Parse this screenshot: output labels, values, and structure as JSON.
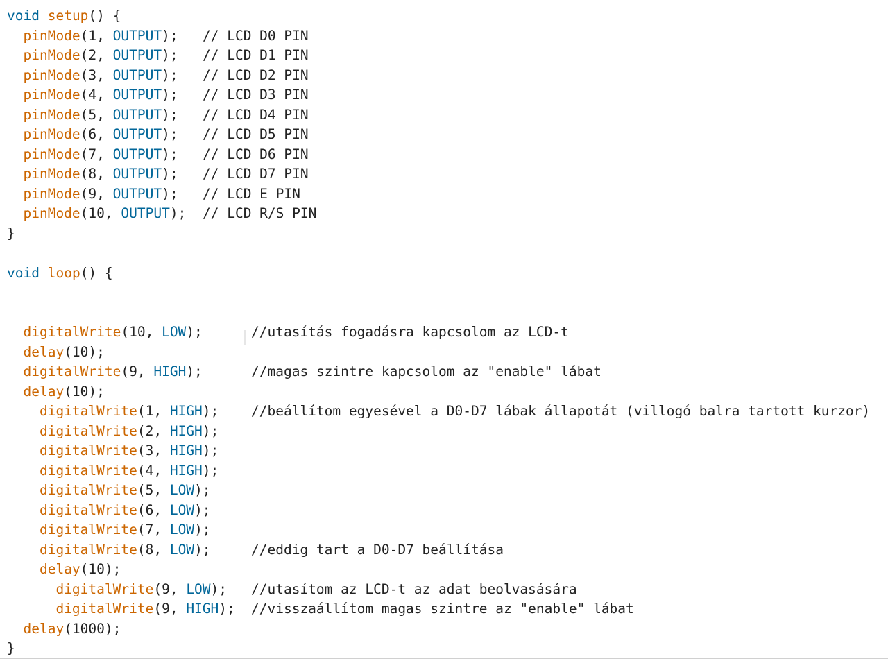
{
  "colors": {
    "keyword": "#cc6600",
    "constant": "#006699",
    "text": "#222222",
    "background": "#ffffff"
  },
  "code": {
    "lines": [
      {
        "tokens": [
          {
            "text": "void",
            "cls": "cst"
          },
          {
            "text": " "
          },
          {
            "text": "setup",
            "cls": "kw"
          },
          {
            "text": "() {"
          }
        ]
      },
      {
        "tokens": [
          {
            "text": "  "
          },
          {
            "text": "pinMode",
            "cls": "kw"
          },
          {
            "text": "(1, "
          },
          {
            "text": "OUTPUT",
            "cls": "cst"
          },
          {
            "text": ");"
          }
        ],
        "comment": "// LCD D0 PIN"
      },
      {
        "tokens": [
          {
            "text": "  "
          },
          {
            "text": "pinMode",
            "cls": "kw"
          },
          {
            "text": "(2, "
          },
          {
            "text": "OUTPUT",
            "cls": "cst"
          },
          {
            "text": ");"
          }
        ],
        "comment": "// LCD D1 PIN"
      },
      {
        "tokens": [
          {
            "text": "  "
          },
          {
            "text": "pinMode",
            "cls": "kw"
          },
          {
            "text": "(3, "
          },
          {
            "text": "OUTPUT",
            "cls": "cst"
          },
          {
            "text": ");"
          }
        ],
        "comment": "// LCD D2 PIN"
      },
      {
        "tokens": [
          {
            "text": "  "
          },
          {
            "text": "pinMode",
            "cls": "kw"
          },
          {
            "text": "(4, "
          },
          {
            "text": "OUTPUT",
            "cls": "cst"
          },
          {
            "text": ");"
          }
        ],
        "comment": "// LCD D3 PIN"
      },
      {
        "tokens": [
          {
            "text": "  "
          },
          {
            "text": "pinMode",
            "cls": "kw"
          },
          {
            "text": "(5, "
          },
          {
            "text": "OUTPUT",
            "cls": "cst"
          },
          {
            "text": ");"
          }
        ],
        "comment": "// LCD D4 PIN"
      },
      {
        "tokens": [
          {
            "text": "  "
          },
          {
            "text": "pinMode",
            "cls": "kw"
          },
          {
            "text": "(6, "
          },
          {
            "text": "OUTPUT",
            "cls": "cst"
          },
          {
            "text": ");"
          }
        ],
        "comment": "// LCD D5 PIN"
      },
      {
        "tokens": [
          {
            "text": "  "
          },
          {
            "text": "pinMode",
            "cls": "kw"
          },
          {
            "text": "(7, "
          },
          {
            "text": "OUTPUT",
            "cls": "cst"
          },
          {
            "text": ");"
          }
        ],
        "comment": "// LCD D6 PIN"
      },
      {
        "tokens": [
          {
            "text": "  "
          },
          {
            "text": "pinMode",
            "cls": "kw"
          },
          {
            "text": "(8, "
          },
          {
            "text": "OUTPUT",
            "cls": "cst"
          },
          {
            "text": ");"
          }
        ],
        "comment": "// LCD D7 PIN"
      },
      {
        "tokens": [
          {
            "text": "  "
          },
          {
            "text": "pinMode",
            "cls": "kw"
          },
          {
            "text": "(9, "
          },
          {
            "text": "OUTPUT",
            "cls": "cst"
          },
          {
            "text": ");"
          }
        ],
        "comment": "// LCD E PIN"
      },
      {
        "tokens": [
          {
            "text": "  "
          },
          {
            "text": "pinMode",
            "cls": "kw"
          },
          {
            "text": "(10, "
          },
          {
            "text": "OUTPUT",
            "cls": "cst"
          },
          {
            "text": ");"
          }
        ],
        "comment": "// LCD R/S PIN"
      },
      {
        "tokens": [
          {
            "text": "}"
          }
        ]
      },
      {
        "tokens": []
      },
      {
        "tokens": [
          {
            "text": "void",
            "cls": "cst"
          },
          {
            "text": " "
          },
          {
            "text": "loop",
            "cls": "kw"
          },
          {
            "text": "() {"
          }
        ]
      },
      {
        "tokens": []
      },
      {
        "tokens": []
      },
      {
        "tokens": [
          {
            "text": "  "
          },
          {
            "text": "digitalWrite",
            "cls": "kw"
          },
          {
            "text": "(10, "
          },
          {
            "text": "LOW",
            "cls": "cst"
          },
          {
            "text": ");"
          }
        ],
        "comment": "//utasítás fogadásra kapcsolom az LCD-t"
      },
      {
        "tokens": [
          {
            "text": "  "
          },
          {
            "text": "delay",
            "cls": "kw"
          },
          {
            "text": "(10);"
          }
        ]
      },
      {
        "tokens": [
          {
            "text": "  "
          },
          {
            "text": "digitalWrite",
            "cls": "kw"
          },
          {
            "text": "(9, "
          },
          {
            "text": "HIGH",
            "cls": "cst"
          },
          {
            "text": ");"
          }
        ],
        "comment": "//magas szintre kapcsolom az \"enable\" lábat"
      },
      {
        "tokens": [
          {
            "text": "  "
          },
          {
            "text": "delay",
            "cls": "kw"
          },
          {
            "text": "(10);"
          }
        ]
      },
      {
        "tokens": [
          {
            "text": "    "
          },
          {
            "text": "digitalWrite",
            "cls": "kw"
          },
          {
            "text": "(1, "
          },
          {
            "text": "HIGH",
            "cls": "cst"
          },
          {
            "text": ");"
          }
        ],
        "comment": "//beállítom egyesével a D0-D7 lábak állapotát (villogó balra tartott kurzor)"
      },
      {
        "tokens": [
          {
            "text": "    "
          },
          {
            "text": "digitalWrite",
            "cls": "kw"
          },
          {
            "text": "(2, "
          },
          {
            "text": "HIGH",
            "cls": "cst"
          },
          {
            "text": ");"
          }
        ]
      },
      {
        "tokens": [
          {
            "text": "    "
          },
          {
            "text": "digitalWrite",
            "cls": "kw"
          },
          {
            "text": "(3, "
          },
          {
            "text": "HIGH",
            "cls": "cst"
          },
          {
            "text": ");"
          }
        ]
      },
      {
        "tokens": [
          {
            "text": "    "
          },
          {
            "text": "digitalWrite",
            "cls": "kw"
          },
          {
            "text": "(4, "
          },
          {
            "text": "HIGH",
            "cls": "cst"
          },
          {
            "text": ");"
          }
        ]
      },
      {
        "tokens": [
          {
            "text": "    "
          },
          {
            "text": "digitalWrite",
            "cls": "kw"
          },
          {
            "text": "(5, "
          },
          {
            "text": "LOW",
            "cls": "cst"
          },
          {
            "text": ");"
          }
        ]
      },
      {
        "tokens": [
          {
            "text": "    "
          },
          {
            "text": "digitalWrite",
            "cls": "kw"
          },
          {
            "text": "(6, "
          },
          {
            "text": "LOW",
            "cls": "cst"
          },
          {
            "text": ");"
          }
        ]
      },
      {
        "tokens": [
          {
            "text": "    "
          },
          {
            "text": "digitalWrite",
            "cls": "kw"
          },
          {
            "text": "(7, "
          },
          {
            "text": "LOW",
            "cls": "cst"
          },
          {
            "text": ");"
          }
        ]
      },
      {
        "tokens": [
          {
            "text": "    "
          },
          {
            "text": "digitalWrite",
            "cls": "kw"
          },
          {
            "text": "(8, "
          },
          {
            "text": "LOW",
            "cls": "cst"
          },
          {
            "text": ");"
          }
        ],
        "comment": "//eddig tart a D0-D7 beállítása"
      },
      {
        "tokens": [
          {
            "text": "    "
          },
          {
            "text": "delay",
            "cls": "kw"
          },
          {
            "text": "(10);"
          }
        ]
      },
      {
        "tokens": [
          {
            "text": "      "
          },
          {
            "text": "digitalWrite",
            "cls": "kw"
          },
          {
            "text": "(9, "
          },
          {
            "text": "LOW",
            "cls": "cst"
          },
          {
            "text": ");"
          }
        ],
        "comment": "//utasítom az LCD-t az adat beolvasására"
      },
      {
        "tokens": [
          {
            "text": "      "
          },
          {
            "text": "digitalWrite",
            "cls": "kw"
          },
          {
            "text": "(9, "
          },
          {
            "text": "HIGH",
            "cls": "cst"
          },
          {
            "text": ");"
          }
        ],
        "comment": "//visszaállítom magas szintre az \"enable\" lábat"
      },
      {
        "tokens": [
          {
            "text": "  "
          },
          {
            "text": "delay",
            "cls": "kw"
          },
          {
            "text": "(1000);"
          }
        ]
      },
      {
        "tokens": [
          {
            "text": "}"
          }
        ]
      }
    ]
  }
}
